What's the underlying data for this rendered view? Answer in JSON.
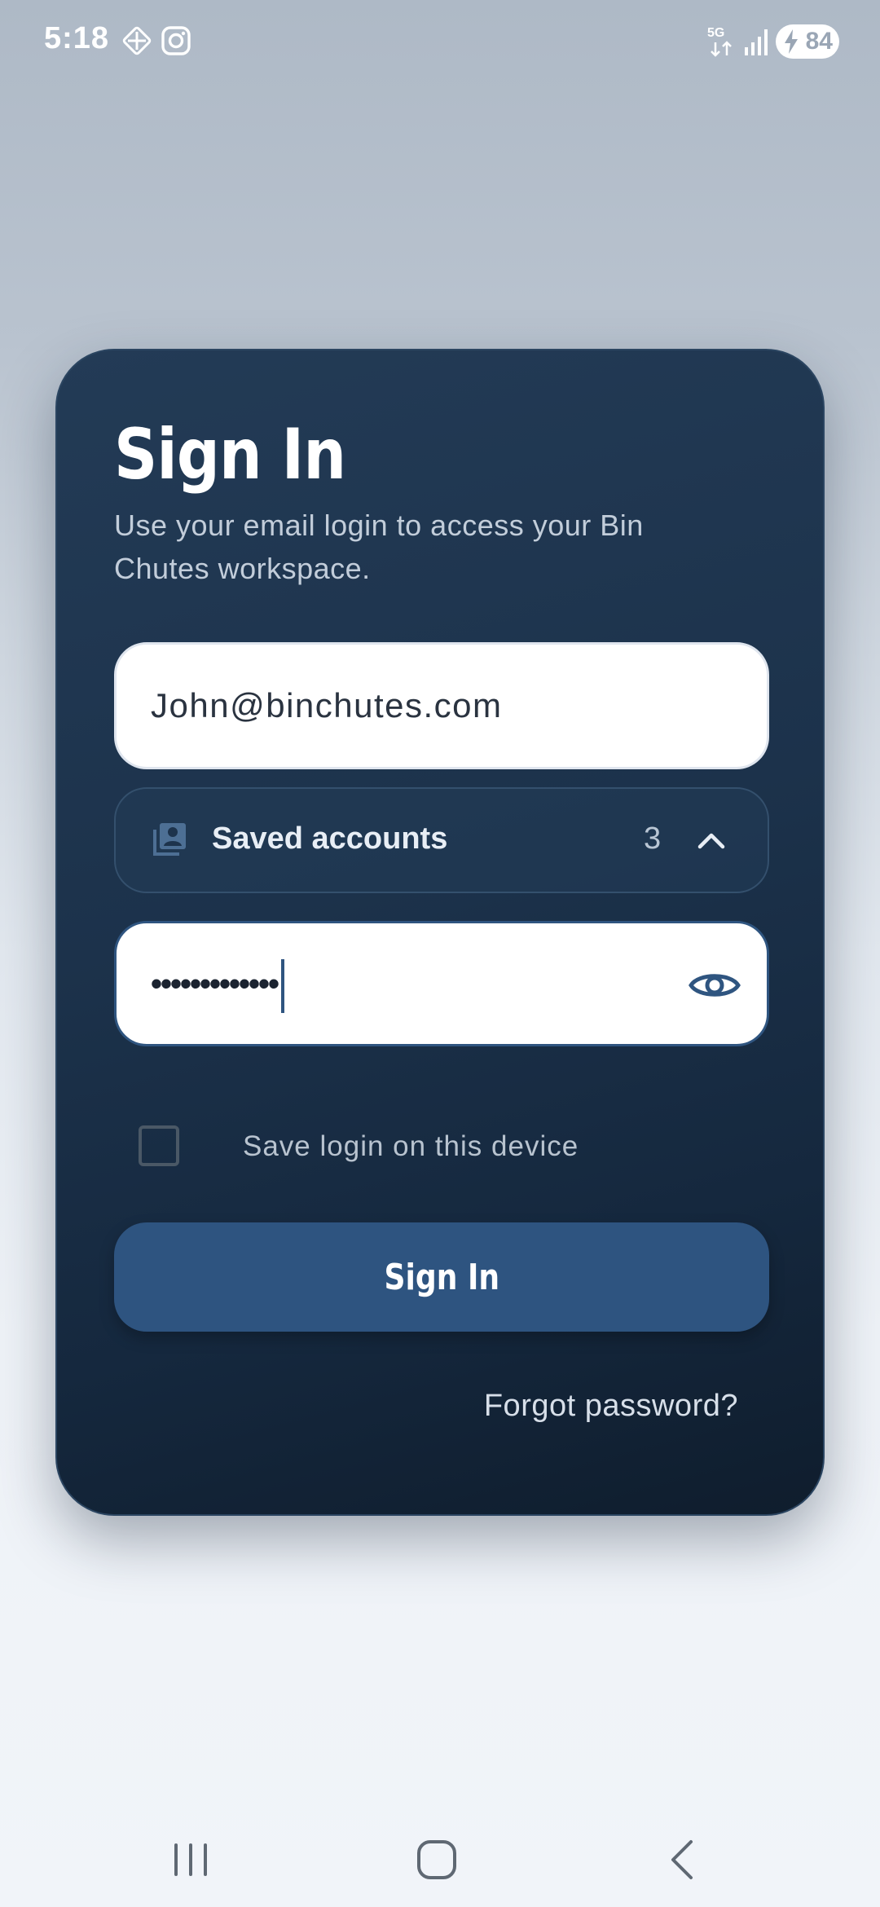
{
  "status_bar": {
    "time": "5:18",
    "network": "5G",
    "battery_level": "84"
  },
  "login_card": {
    "title": "Sign In",
    "subtitle": "Use your email login to access your Bin Chutes workspace.",
    "email_value": "John@binchutes.com",
    "saved_accounts_label": "Saved accounts",
    "saved_accounts_count": "3",
    "password_masked": "•••••••••••••",
    "remember_label": "Save login on this device",
    "remember_checked": false,
    "signin_label": "Sign In",
    "forgot_label": "Forgot password?"
  },
  "colors": {
    "card_bg": "#1c324b",
    "button_bg": "#2e5480",
    "accent": "#2f5580"
  },
  "icons": {
    "saved_accounts": "account-box-icon",
    "toggle": "chevron-up-icon",
    "password_visibility": "eye-icon"
  }
}
